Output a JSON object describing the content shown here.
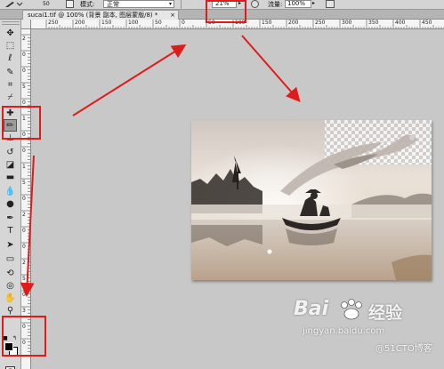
{
  "options_bar": {
    "brush_size": "50",
    "mode_label": "模式:",
    "mode_value": "正常",
    "opacity_value": "21%",
    "flow_label": "流量:",
    "flow_value": "100%"
  },
  "document_tab": {
    "title": "sucai1.tif @ 100% (背景 副本, 图层蒙版/8) *",
    "close": "×"
  },
  "rulers": {
    "horizontal": [
      "250",
      "200",
      "150",
      "100",
      "50",
      "0",
      "50",
      "100",
      "150",
      "200",
      "250",
      "300",
      "350",
      "400",
      "450"
    ],
    "vertical": [
      "2",
      "0",
      "0",
      "5",
      "0",
      "1",
      "0",
      "0",
      "1",
      "5",
      "0",
      "2",
      "0",
      "0",
      "2",
      "5",
      "0",
      "3",
      "0",
      "0"
    ]
  },
  "toolbar": {
    "tools": [
      {
        "name": "move-tool",
        "glyph": "✥"
      },
      {
        "name": "marquee-tool",
        "glyph": "⬚"
      },
      {
        "name": "lasso-tool",
        "glyph": "ℓ"
      },
      {
        "name": "quick-select-tool",
        "glyph": "✎"
      },
      {
        "name": "crop-tool",
        "glyph": "⌗"
      },
      {
        "name": "eyedropper-tool",
        "glyph": "⌿"
      },
      {
        "name": "spot-heal-tool",
        "glyph": "✚"
      },
      {
        "name": "brush-tool",
        "glyph": "✏"
      },
      {
        "name": "clone-stamp-tool",
        "glyph": "⊥"
      },
      {
        "name": "history-brush-tool",
        "glyph": "↺"
      },
      {
        "name": "eraser-tool",
        "glyph": "◪"
      },
      {
        "name": "gradient-tool",
        "glyph": "▬"
      },
      {
        "name": "blur-tool",
        "glyph": "💧"
      },
      {
        "name": "dodge-tool",
        "glyph": "●"
      },
      {
        "name": "pen-tool",
        "glyph": "✒"
      },
      {
        "name": "type-tool",
        "glyph": "T"
      },
      {
        "name": "path-select-tool",
        "glyph": "➤"
      },
      {
        "name": "shape-tool",
        "glyph": "▭"
      },
      {
        "name": "3d-rotate-tool",
        "glyph": "⟲"
      },
      {
        "name": "3d-orbit-tool",
        "glyph": "◎"
      },
      {
        "name": "hand-tool",
        "glyph": "✋"
      },
      {
        "name": "zoom-tool",
        "glyph": "⚲"
      }
    ]
  },
  "watermark": {
    "brand_left": "Bai",
    "brand_right": "经验",
    "url": "jingyan.baidu.com",
    "blog": "@51CTO博客"
  },
  "colors": {
    "highlight": "#e01b1b",
    "toolbar_bg": "#d6d6d6",
    "workspace_bg": "#c8c8c8"
  }
}
